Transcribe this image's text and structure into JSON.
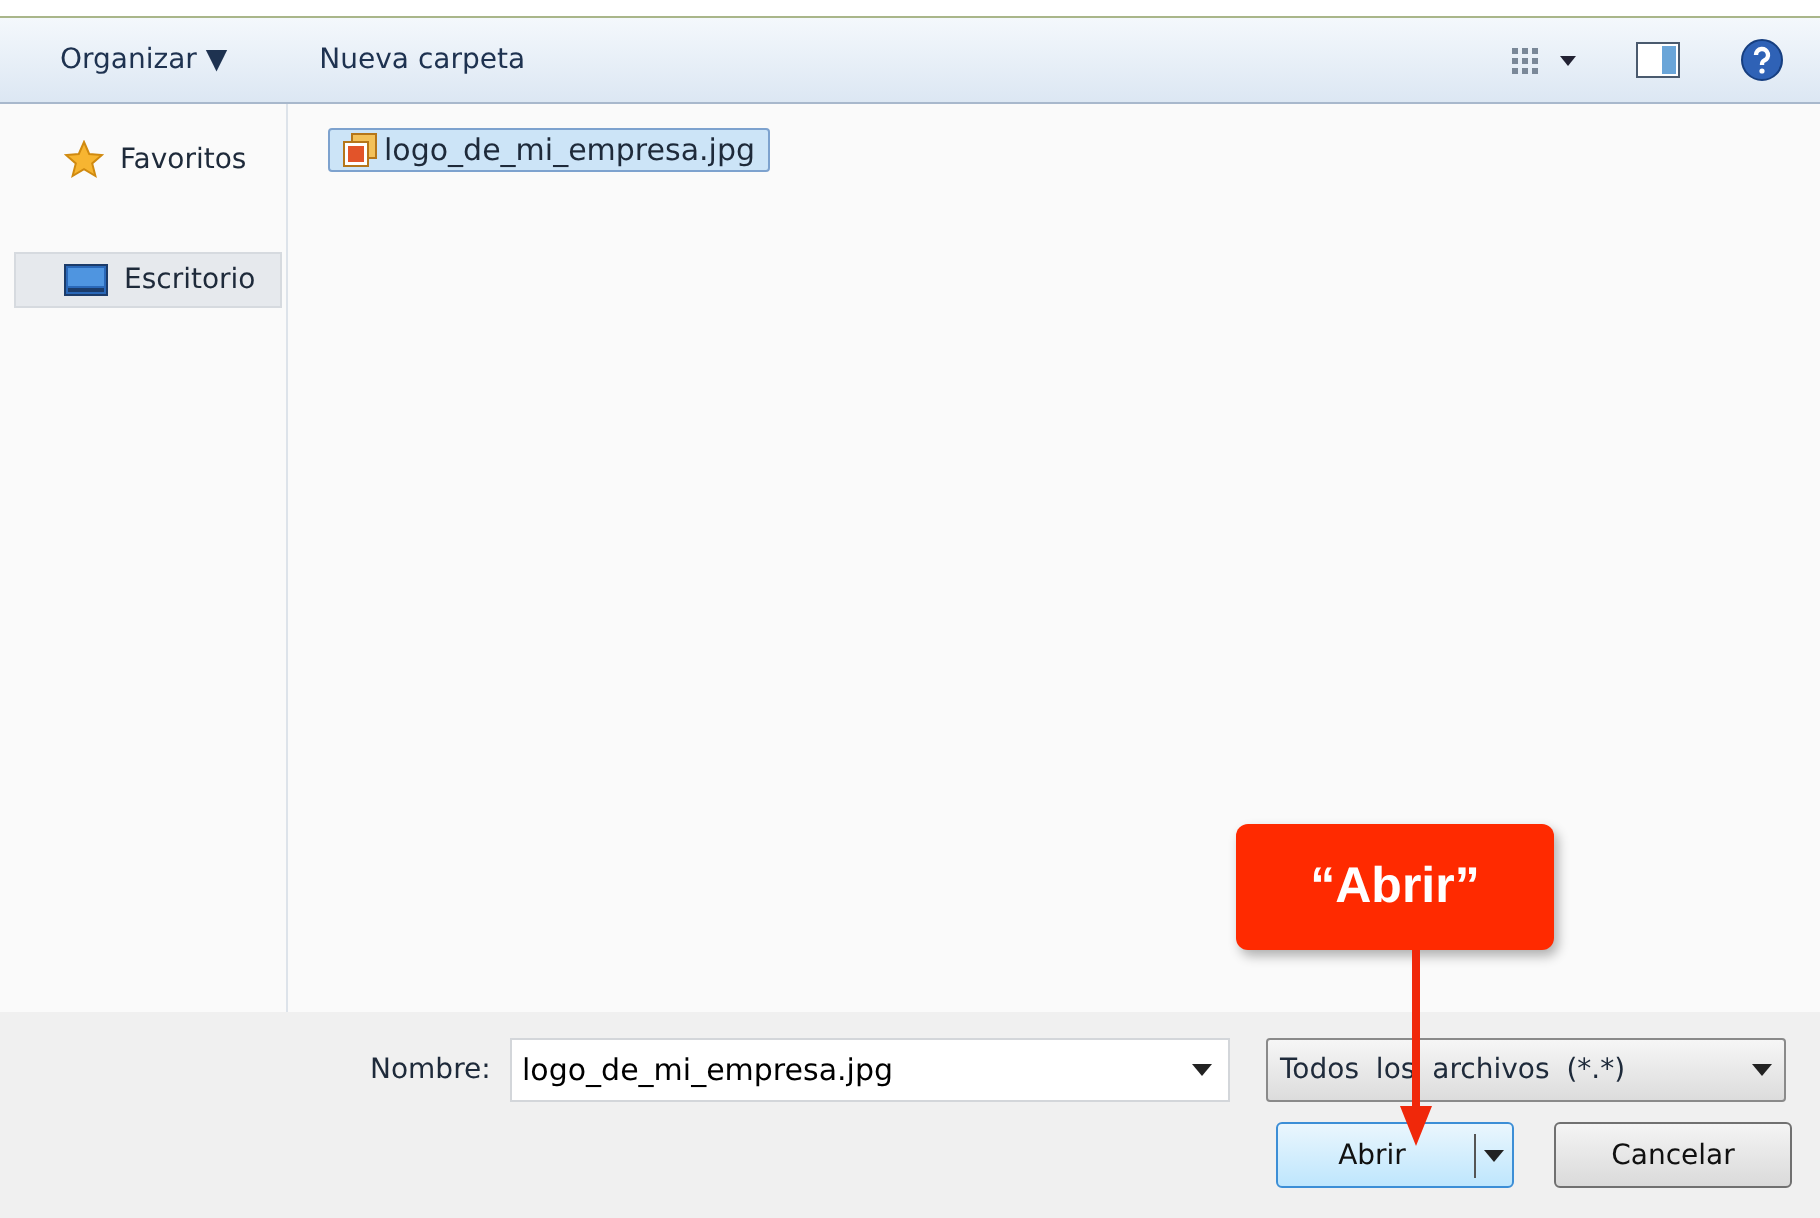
{
  "toolbar": {
    "organize": "Organizar ▼",
    "new_folder": "Nueva carpeta"
  },
  "sidebar": {
    "items": [
      {
        "label": "Favoritos",
        "kind": "star",
        "selected": false
      },
      {
        "label": "Escritorio",
        "kind": "desktop",
        "selected": true
      }
    ]
  },
  "files": [
    {
      "name": "logo_de_mi_empresa.jpg",
      "selected": true
    }
  ],
  "bottom": {
    "name_label": "Nombre:",
    "name_value": "logo_de_mi_empresa.jpg",
    "filter": "Todos los archivos (*.*)",
    "open_button": "Abrir",
    "cancel_button": "Cancelar"
  },
  "callout": {
    "text": "“Abrir”"
  }
}
